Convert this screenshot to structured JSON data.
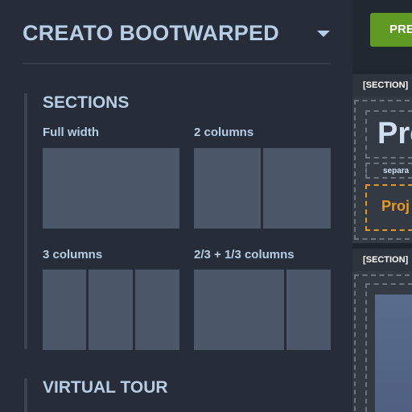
{
  "panel": {
    "title": "CREATO BOOTWARPED",
    "sections_group": {
      "title": "SECTIONS",
      "layouts": [
        {
          "label": "Full width"
        },
        {
          "label": "2 columns"
        },
        {
          "label": "3 columns"
        },
        {
          "label": "2/3 + 1/3 columns"
        }
      ]
    },
    "virtual_tour_group": {
      "title": "VIRTUAL TOUR"
    }
  },
  "preview": {
    "button_label": "PRE",
    "section_label_1": "[SECTION]",
    "section_label_2": "[SECTION]",
    "heading": "Pro",
    "separator_text": "separa",
    "project_text": "Proj"
  },
  "colors": {
    "panel_bg": "#262d38",
    "heading_text": "#b6cde4",
    "layout_block": "#4c5869",
    "button_green": "#5f9a23",
    "accent_orange": "#e59b1f"
  }
}
